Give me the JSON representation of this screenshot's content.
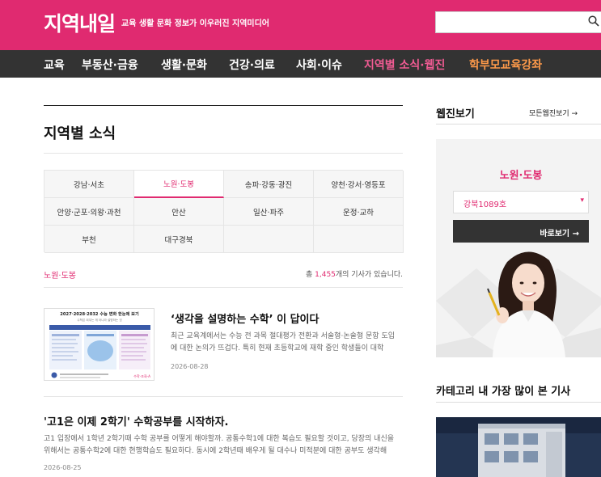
{
  "header": {
    "logo": "지역내일",
    "tagline": "교육 생활 문화 정보가 이우러진 지역미디어",
    "search_placeholder": ""
  },
  "nav": [
    {
      "label": "교육"
    },
    {
      "label": "부동산·금융"
    },
    {
      "label": "생활·문화"
    },
    {
      "label": "건강·의료"
    },
    {
      "label": "사회·이슈"
    },
    {
      "label": "지역별 소식·웹진"
    },
    {
      "label": "학부모교육강좌"
    }
  ],
  "section": {
    "title": "지역별 소식",
    "regions": [
      "강남·서초",
      "노원·도봉",
      "송파·강동·광진",
      "양천·강서·영등포",
      "안양·군포·의왕·과천",
      "안산",
      "일산·파주",
      "운정·교하",
      "부천",
      "대구경북"
    ],
    "selected_region": "노원·도봉",
    "current_region": "노원·도봉",
    "count_prefix": "총 ",
    "count": "1,455",
    "count_suffix": "개의 기사가 있습니다."
  },
  "articles": [
    {
      "title": "‘생각을 설명하는 수학’ 이 답이다",
      "summary": "최근 교육계에서는 수능 전 과목 절대평가 전환과 서술형·논술형 문항 도입에 대한 논의가 뜨겁다. 특히 현재 초등학교에 재학 중인 학생들이 대학",
      "date": "2026-08-28",
      "thumb_heading": "2027·2028·2032 수능 변화 한눈에 보기",
      "thumb_sub": "수학은 외우는 게 아니라 설명하는 것",
      "thumb_brand": "수학·조화·A"
    },
    {
      "title": "'고1은 이제 2학기' 수학공부를 시작하자.",
      "summary": "고1 입장에서 1학년 2학기때 수학 공부를 어떻게 해야할까. 공통수학1에 대한 복습도 필요할 것이고, 당장의 내신을 위해서는 공통수학2에 대한 현행학습도 필요하다. 동시에 2학년때 배우게 될 대수나 미적분에 대한 공부도 생각해",
      "date": "2026-08-25"
    }
  ],
  "sidebar": {
    "webzine_title": "웹진보기",
    "webzine_more": "모든웹진보기 →",
    "webzine_region": "노원·도봉",
    "edition_selected": "강북1089호",
    "go_button": "바로보기 →",
    "most_viewed_title": "카테고리 내 가장 많이 본 기사"
  },
  "colors": {
    "brand": "#e02a70",
    "nav_bg": "#333333",
    "highlight": "#ff9a4a"
  }
}
